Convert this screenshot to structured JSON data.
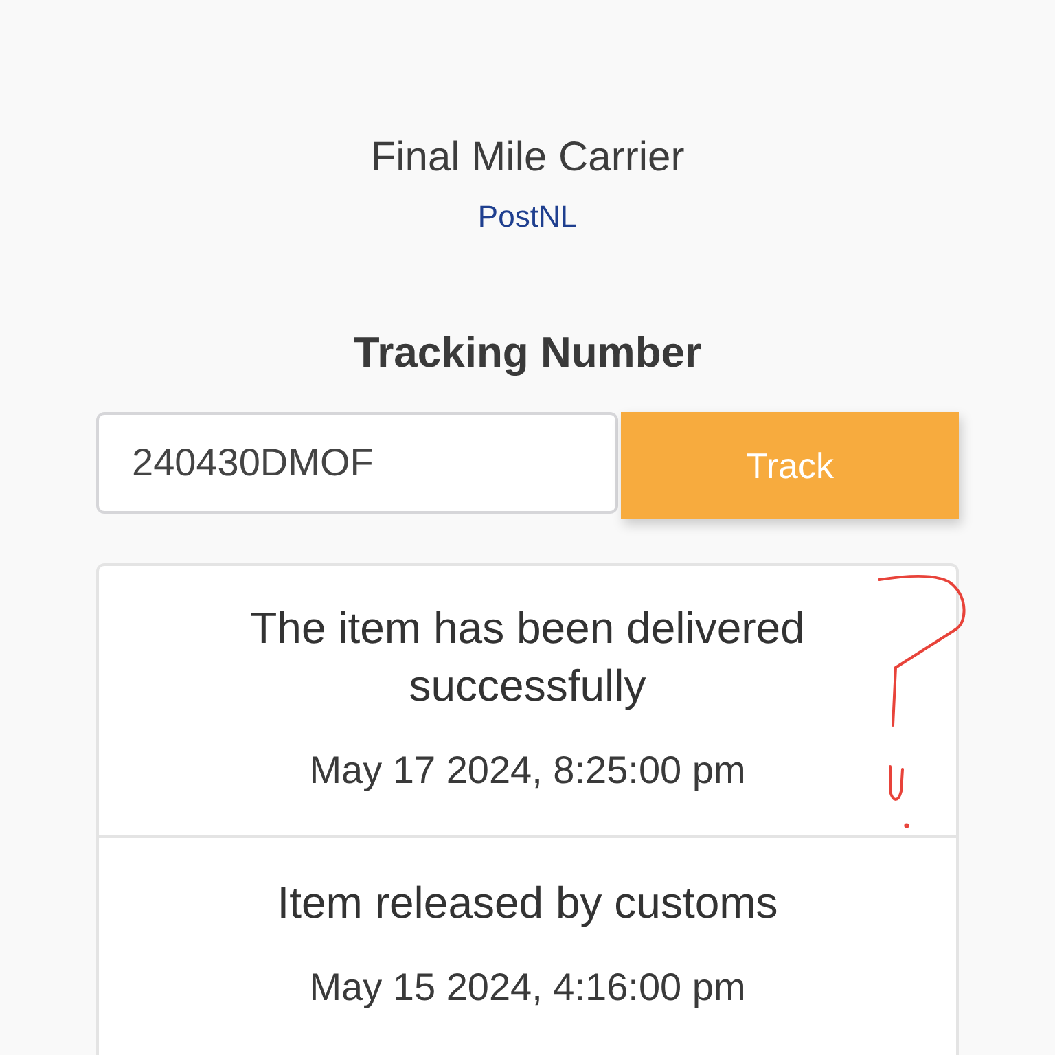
{
  "carrier": {
    "label": "Final Mile Carrier",
    "name": "PostNL"
  },
  "tracking": {
    "heading": "Tracking Number",
    "value": "240430DMOF",
    "button": "Track"
  },
  "events": [
    {
      "status": "The item has been delivered successfully",
      "time": "May 17 2024, 8:25:00 pm"
    },
    {
      "status": "Item released by customs",
      "time": "May 15 2024, 4:16:00 pm"
    }
  ]
}
